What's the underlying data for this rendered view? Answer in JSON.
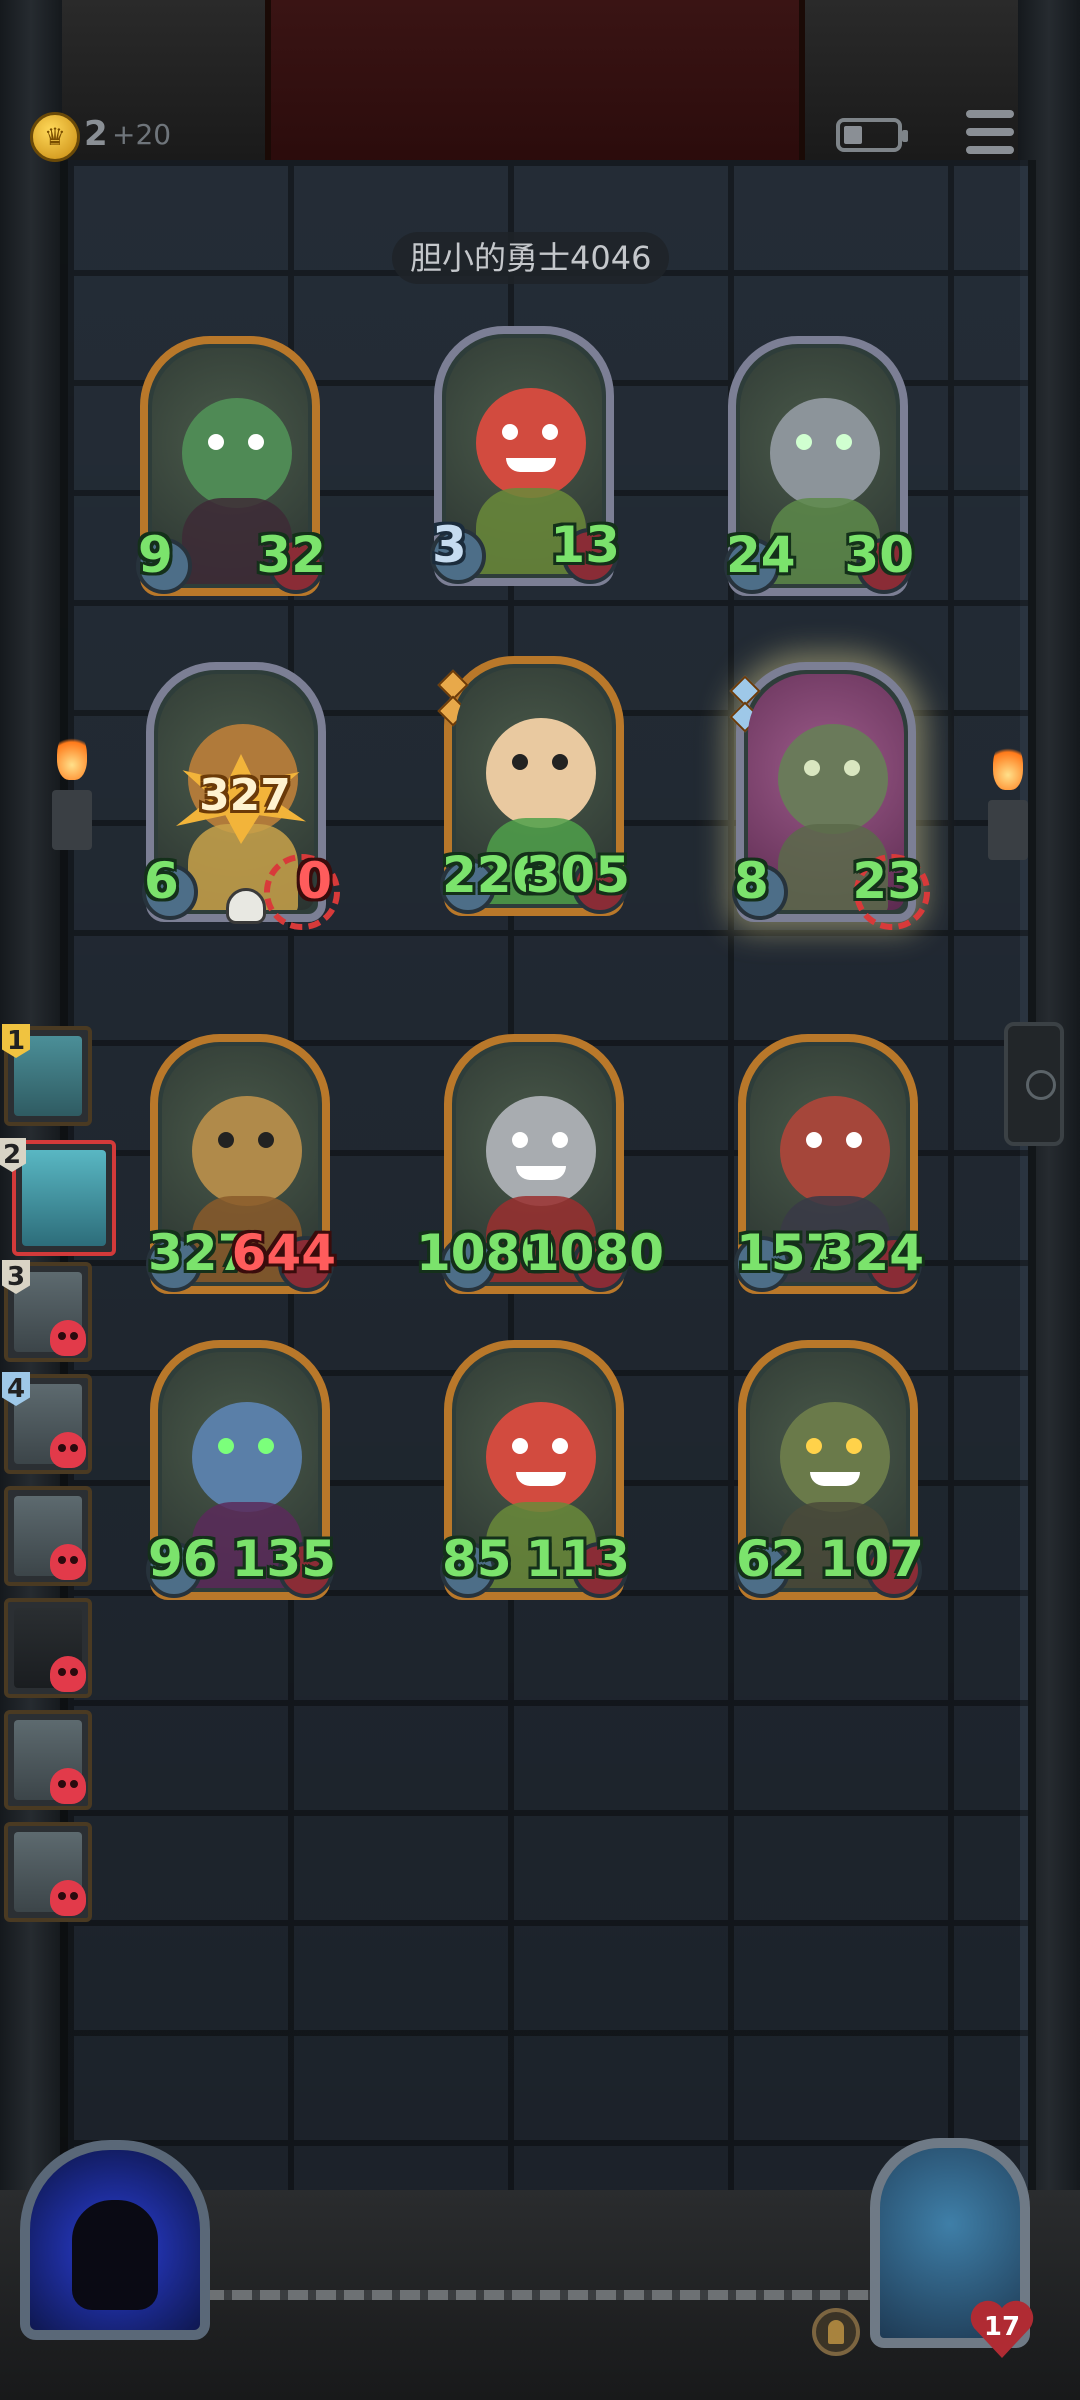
{
  "header": {
    "gold": "2",
    "gold_bonus": "+20",
    "opponent_name": "胆小的勇士4046"
  },
  "enemy_board": [
    {
      "attack": "9",
      "health": "32",
      "frame": "gold"
    },
    {
      "attack": "3",
      "health": "13",
      "frame": "silver"
    },
    {
      "attack": "24",
      "health": "30",
      "frame": "silver"
    },
    {
      "attack": "6",
      "health": "0",
      "frame": "silver",
      "damage_burst": "327",
      "targeted": true
    },
    {
      "attack": "226",
      "health": "305",
      "frame": "gold"
    },
    {
      "attack": "8",
      "health": "23",
      "frame": "silver",
      "targeted": true,
      "glowing": true
    }
  ],
  "player_board": [
    {
      "attack": "327",
      "health": "644",
      "health_damaged": true
    },
    {
      "attack": "1080",
      "health": "1080"
    },
    {
      "attack": "157",
      "health": "324"
    },
    {
      "attack": "96",
      "health": "135"
    },
    {
      "attack": "85",
      "health": "113"
    },
    {
      "attack": "62",
      "health": "107"
    }
  ],
  "roster": [
    {
      "rank": "1",
      "state": "alive"
    },
    {
      "rank": "2",
      "state": "active"
    },
    {
      "rank": "3",
      "state": "dead"
    },
    {
      "rank": "4",
      "state": "dead"
    },
    {
      "rank": "",
      "state": "dead"
    },
    {
      "rank": "",
      "state": "dead"
    },
    {
      "rank": "",
      "state": "dead"
    },
    {
      "rank": "",
      "state": "dead"
    }
  ],
  "hero": {
    "health": "17"
  },
  "icons": {
    "coin": "crown-coin-icon",
    "battery": "battery-icon",
    "menu": "hamburger-menu-icon",
    "dead": "skull-icon",
    "heart": "heart-icon"
  },
  "colors": {
    "stat_green": "#7be36c",
    "stat_red": "#ff5c5c",
    "frame_gold": "#b9782a",
    "frame_silver": "#7c7f95",
    "active_border": "#d33a3a"
  }
}
